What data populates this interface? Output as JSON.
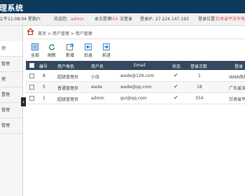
{
  "header": {
    "title": "理系统"
  },
  "infobar": {
    "datetime": "上午11:08:04 星期六",
    "welcome_label": "欢迎您:",
    "user": "admin",
    "login_count_prefix": "本次是第",
    "login_count": "354",
    "login_count_suffix": "次登录",
    "ip_label": "登录IP:",
    "ip": "27.224.147.193",
    "location_label": "登录位置:",
    "location": "甘肃省平凉市电"
  },
  "sidebar": {
    "items": [
      "理",
      "管理",
      "理",
      "置理",
      "管理",
      "管理"
    ],
    "active_index": 0,
    "toggle_icon": "‹"
  },
  "breadcrumb": {
    "home": "首页",
    "sep": ">",
    "level1": "用户管理",
    "level2": "用户管理"
  },
  "toolbar": {
    "all": "全部",
    "refresh": "刷新",
    "add": "新增",
    "back": "后退",
    "forward": "前进"
  },
  "table": {
    "columns": [
      "编号",
      "用户角色",
      "用户名",
      "Email",
      "状态",
      "登录次数",
      "登录"
    ],
    "rows": [
      {
        "id": "8",
        "role": "超级管理员",
        "username": "小张",
        "email": "wade@126.com",
        "status": "✔",
        "logins": "1",
        "location": "IANA保留"
      },
      {
        "id": "5",
        "role": "普通管理员",
        "username": "wade",
        "email": "wade@qq.com",
        "status": "✔",
        "logins": "18",
        "location": "广东省深圳"
      },
      {
        "id": "1",
        "role": "超级管理员",
        "username": "admin",
        "email": "gui@qq.com",
        "status": "✔",
        "logins": "354",
        "location": "甘肃省平凉"
      }
    ]
  },
  "colors": {
    "header": "#0e3a5e",
    "grid_header": "#34485e",
    "accent": "#2a7bc0",
    "status_ok": "#43a047",
    "highlight": "#d9534f"
  }
}
